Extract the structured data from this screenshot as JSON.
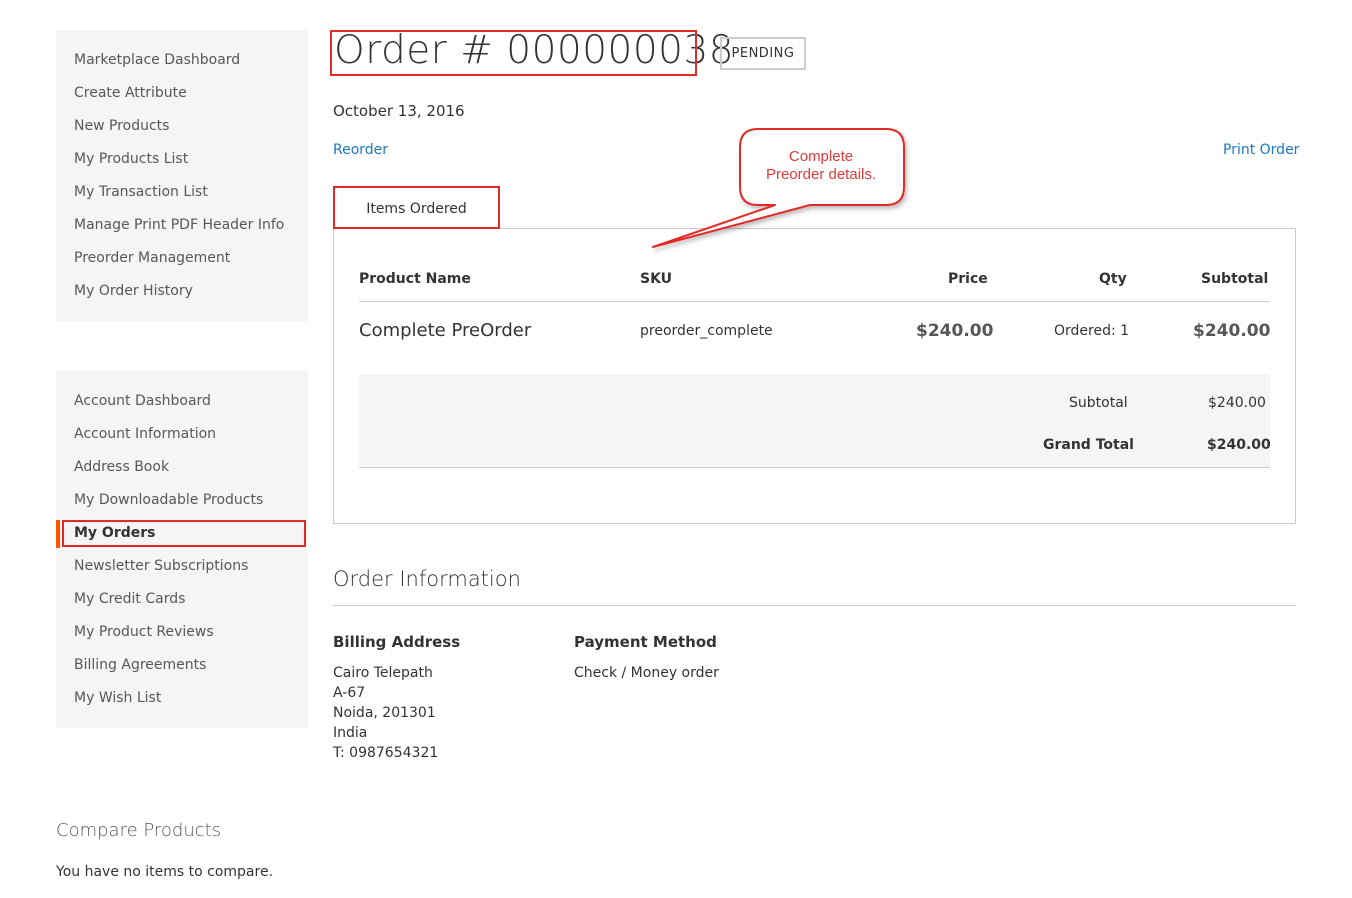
{
  "sidebar": {
    "marketplace_items": [
      {
        "label": "Marketplace Dashboard"
      },
      {
        "label": "Create Attribute"
      },
      {
        "label": "New Products"
      },
      {
        "label": "My Products List"
      },
      {
        "label": "My Transaction List"
      },
      {
        "label": "Manage Print PDF Header Info"
      },
      {
        "label": "Preorder Management"
      },
      {
        "label": "My Order History"
      }
    ],
    "account_items": [
      {
        "label": "Account Dashboard"
      },
      {
        "label": "Account Information"
      },
      {
        "label": "Address Book"
      },
      {
        "label": "My Downloadable Products"
      },
      {
        "label": "My Orders",
        "active": true
      },
      {
        "label": "Newsletter Subscriptions"
      },
      {
        "label": "My Credit Cards"
      },
      {
        "label": "My Product Reviews"
      },
      {
        "label": "Billing Agreements"
      },
      {
        "label": "My Wish List"
      }
    ]
  },
  "compare": {
    "title": "Compare Products",
    "empty_text": "You have no items to compare."
  },
  "order": {
    "title": "Order # 000000038",
    "status": "PENDING",
    "date": "October 13, 2016",
    "reorder_label": "Reorder",
    "print_label": "Print Order",
    "tab_label": "Items Ordered"
  },
  "items_table": {
    "headers": {
      "product": "Product Name",
      "sku": "SKU",
      "price": "Price",
      "qty": "Qty",
      "subtotal": "Subtotal"
    },
    "rows": [
      {
        "product": "Complete PreOrder",
        "sku": "preorder_complete",
        "price": "$240.00",
        "qty": "Ordered: 1",
        "subtotal": "$240.00"
      }
    ],
    "totals": {
      "subtotal_label": "Subtotal",
      "subtotal_value": "$240.00",
      "grand_total_label": "Grand Total",
      "grand_total_value": "$240.00"
    }
  },
  "order_info": {
    "title": "Order Information",
    "billing_title": "Billing Address",
    "billing_lines": [
      "Cairo Telepath",
      "A-67",
      "Noida, 201301",
      "India",
      "T: 0987654321"
    ],
    "payment_title": "Payment Method",
    "payment_method": "Check / Money order"
  },
  "annotation": {
    "text_line1": "Complete",
    "text_line2": "Preorder details."
  },
  "colors": {
    "link": "#1979c3",
    "annotation_red": "#e02b27",
    "sidebar_bg": "#f5f5f5",
    "active_marker": "#ff5501"
  }
}
